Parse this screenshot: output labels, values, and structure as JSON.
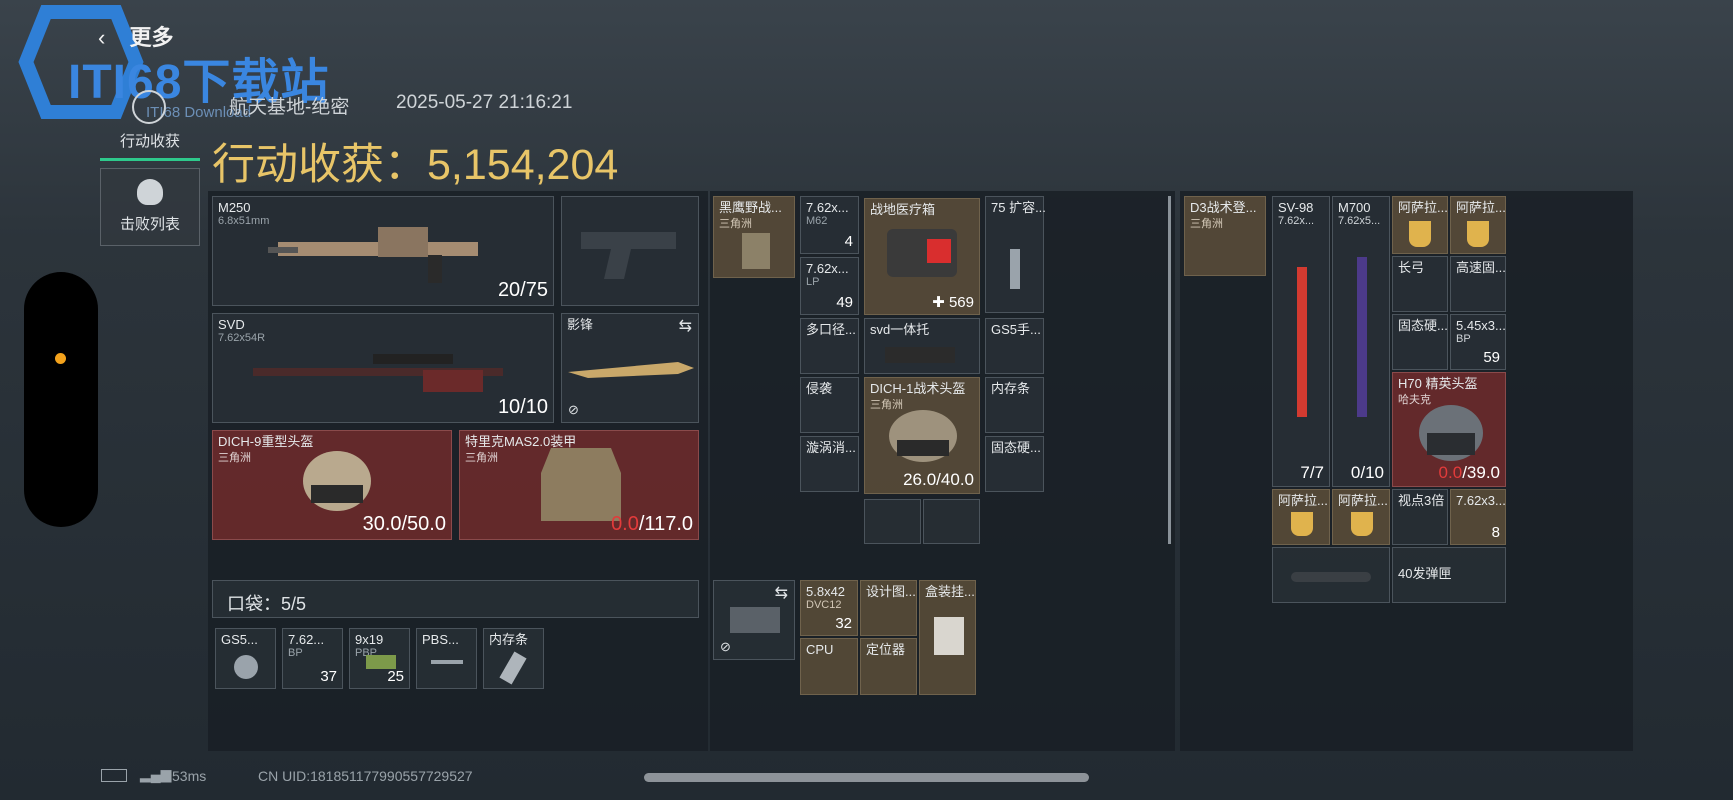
{
  "header": {
    "back_label": "更多",
    "map_name": "航天基地-绝密",
    "datetime": "2025-05-27 21:16:21",
    "haul_label": "行动收获：",
    "haul_value": "5,154,204"
  },
  "watermark": {
    "logo_text": "ITI68下载站",
    "sub_text": "ITI68 Download"
  },
  "sidebar": {
    "tab_haul": "行动收获",
    "tab_kills": "击败列表"
  },
  "weapons": [
    {
      "name": "M250",
      "caliber": "6.8x51mm",
      "ammo": "20/75"
    },
    {
      "name": "SVD",
      "caliber": "7.62x54R",
      "ammo": "10/10"
    },
    {
      "name": "影锋"
    }
  ],
  "armor": [
    {
      "name": "DICH-9重型头盔",
      "sub": "三角洲",
      "dur": "30.0/50.0"
    },
    {
      "name": "特里克MAS2.0装甲",
      "sub": "三角洲",
      "dur_cur": "0.0",
      "dur_max": "/117.0"
    }
  ],
  "pocket": {
    "label": "口袋：5/5",
    "items": [
      {
        "name": "GS5..."
      },
      {
        "name": "7.62...",
        "sub": "BP",
        "count": "37"
      },
      {
        "name": "9x19",
        "sub": "PBP",
        "count": "25"
      },
      {
        "name": "PBS..."
      },
      {
        "name": "内存条"
      }
    ]
  },
  "middle": {
    "chest": {
      "name": "黑鹰野战...",
      "sub": "三角洲"
    },
    "ammo1": {
      "name": "7.62x...",
      "sub": "M62",
      "count": "4"
    },
    "ammo2": {
      "name": "7.62x...",
      "sub": "LP",
      "count": "49"
    },
    "med": {
      "name": "战地医疗箱",
      "count": "569"
    },
    "ext": {
      "name": "75 扩容..."
    },
    "multi": {
      "name": "多口径..."
    },
    "stock": {
      "name": "svd一体托"
    },
    "gs5": {
      "name": "GS5手..."
    },
    "invade": {
      "name": "侵袭"
    },
    "helmet": {
      "name": "DICH-1战术头盔",
      "sub": "三角洲",
      "dur": "26.0/40.0"
    },
    "mem": {
      "name": "内存条"
    },
    "vortex": {
      "name": "漩涡消..."
    },
    "ssd": {
      "name": "固态硬..."
    },
    "bag": [
      {
        "name": "5.8x42",
        "sub": "DVC12",
        "count": "32"
      },
      {
        "name": "设计图..."
      },
      {
        "name": "盒装挂..."
      },
      {
        "name": "CPU"
      },
      {
        "name": "定位器"
      }
    ]
  },
  "right": {
    "vest": {
      "name": "D3战术登...",
      "sub": "三角洲"
    },
    "sv98": {
      "name": "SV-98",
      "sub": "7.62x...",
      "ammo": "7/7"
    },
    "m700": {
      "name": "M700",
      "sub": "7.62x5...",
      "ammo": "0/10"
    },
    "cells": [
      {
        "name": "阿萨拉..."
      },
      {
        "name": "阿萨拉..."
      },
      {
        "name": "长弓"
      },
      {
        "name": "高速固..."
      },
      {
        "name": "固态硬..."
      },
      {
        "name": "5.45x3...",
        "sub": "BP",
        "count": "59"
      }
    ],
    "h70": {
      "name": "H70 精英头盔",
      "sub": "哈夫克",
      "dur_cur": "0.0",
      "dur_max": "/39.0"
    },
    "bottom": [
      {
        "name": "阿萨拉..."
      },
      {
        "name": "阿萨拉..."
      },
      {
        "name": "视点3倍"
      },
      {
        "name": "7.62x3...",
        "count": "8"
      }
    ],
    "mag": {
      "name": "40发弹匣"
    }
  },
  "status": {
    "ping": "53ms",
    "uid": "CN UID:18185117799055772952​7"
  }
}
